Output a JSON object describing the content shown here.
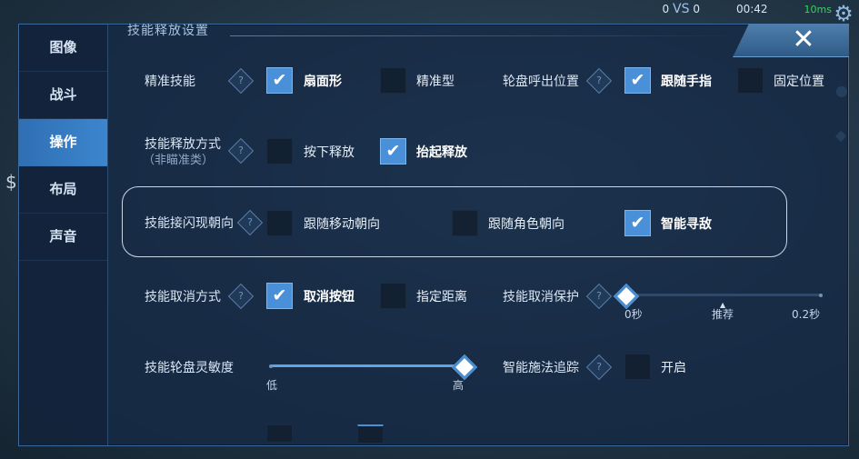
{
  "status_bar": {
    "time": "00:42",
    "ping": "10ms",
    "score_left": "0",
    "vs": "VS",
    "score_right": "0"
  },
  "sidebar": {
    "tabs": [
      {
        "label": "图像",
        "active": false
      },
      {
        "label": "战斗",
        "active": false
      },
      {
        "label": "操作",
        "active": true
      },
      {
        "label": "布局",
        "active": false
      },
      {
        "label": "声音",
        "active": false
      }
    ]
  },
  "section_title": "技能释放设置",
  "close_label": "✕",
  "help_glyph": "?",
  "rows": {
    "precise_skill": {
      "label": "精准技能",
      "options": [
        {
          "label": "扇面形",
          "checked": true
        },
        {
          "label": "精准型",
          "checked": false
        }
      ]
    },
    "wheel_position": {
      "label": "轮盘呼出位置",
      "options": [
        {
          "label": "跟随手指",
          "checked": true
        },
        {
          "label": "固定位置",
          "checked": false
        }
      ]
    },
    "release_mode": {
      "label": "技能释放方式",
      "sublabel": "（非瞄准类）",
      "options": [
        {
          "label": "按下释放",
          "checked": false
        },
        {
          "label": "抬起释放",
          "checked": true
        }
      ]
    },
    "flash_direction": {
      "label": "技能接闪现朝向",
      "options": [
        {
          "label": "跟随移动朝向",
          "checked": false
        },
        {
          "label": "跟随角色朝向",
          "checked": false
        },
        {
          "label": "智能寻敌",
          "checked": true
        }
      ]
    },
    "cancel_mode": {
      "label": "技能取消方式",
      "options": [
        {
          "label": "取消按钮",
          "checked": true
        },
        {
          "label": "指定距离",
          "checked": false
        }
      ]
    },
    "cancel_protect": {
      "label": "技能取消保护",
      "min_label": "0秒",
      "mid_label": "推荐",
      "max_label": "0.2秒",
      "value_fraction": 0.0
    },
    "wheel_sensitivity": {
      "label": "技能轮盘灵敏度",
      "min_label": "低",
      "max_label": "高",
      "value_fraction": 1.0
    },
    "smart_tracking": {
      "label": "智能施法追踪",
      "option": {
        "label": "开启",
        "checked": false
      }
    }
  }
}
